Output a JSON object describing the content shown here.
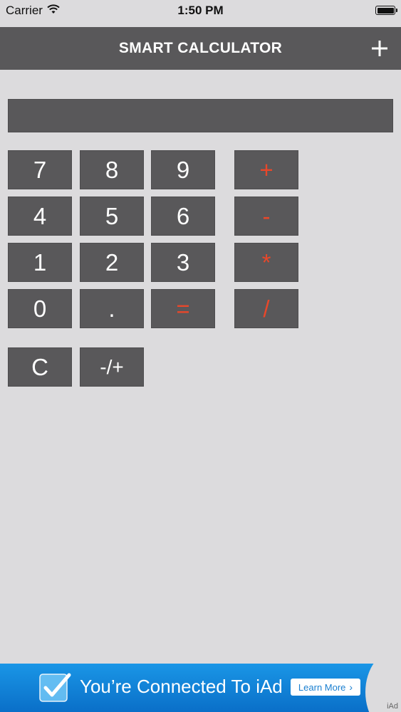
{
  "status_bar": {
    "carrier": "Carrier",
    "time": "1:50 PM"
  },
  "nav": {
    "title": "SMART CALCULATOR",
    "add_icon": "plus-icon"
  },
  "display": {
    "value": ""
  },
  "keys": {
    "k7": "7",
    "k8": "8",
    "k9": "9",
    "plus": "+",
    "k4": "4",
    "k5": "5",
    "k6": "6",
    "minus": "-",
    "k1": "1",
    "k2": "2",
    "k3": "3",
    "multiply": "*",
    "k0": "0",
    "dot": ".",
    "equals": "=",
    "divide": "/",
    "clear": "C",
    "negate": "-/+"
  },
  "ad": {
    "text": "You’re Connected To iAd",
    "learn_more": "Learn More",
    "badge": "iAd"
  },
  "colors": {
    "background": "#dcdbdd",
    "key": "#59585a",
    "operator": "#e8472a",
    "ad_blue": "#1a86da"
  }
}
